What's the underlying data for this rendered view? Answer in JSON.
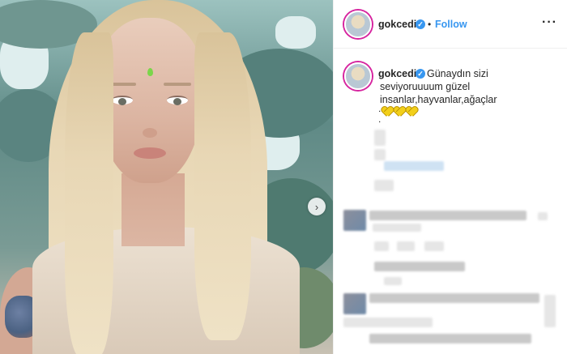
{
  "post": {
    "username": "gokcedi",
    "verified": true,
    "follow_label": "Follow",
    "separator": "•",
    "more_label": "···"
  },
  "caption": {
    "username": "gokcedi",
    "lines": [
      "Günaydın sizi",
      "seviyoruuuum güzel",
      "insanlar,hayvanlar,ağaçlar"
    ],
    "emoji": "yellow-heart",
    "emoji_count": 3,
    "trailing": [
      ".",
      "."
    ]
  },
  "carousel": {
    "next_icon": "chevron-right-icon",
    "next_glyph": "›"
  },
  "colors": {
    "accent": "#3897f0",
    "heart": "#f2cf1a",
    "ring": "#d6249f"
  }
}
